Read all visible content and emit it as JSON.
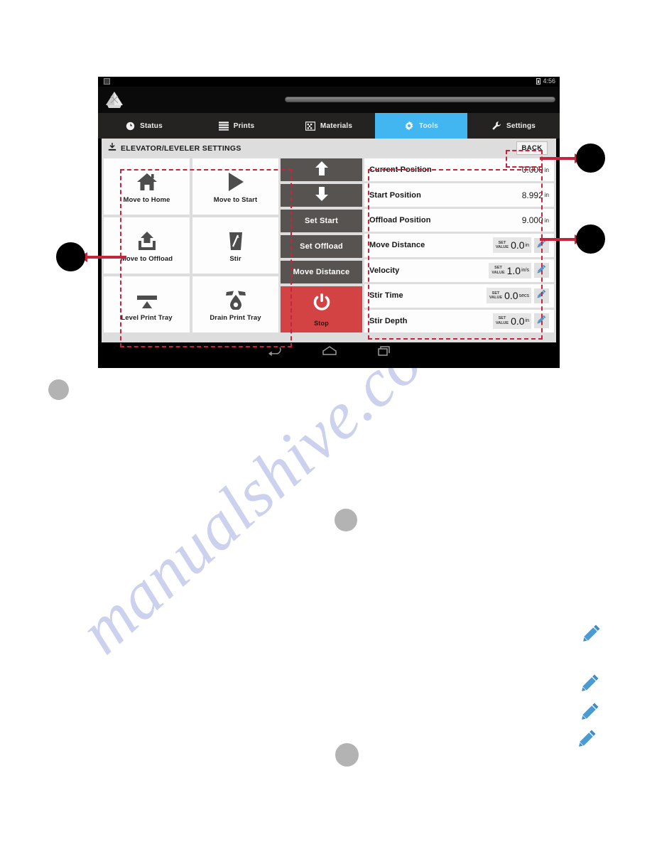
{
  "watermark": {
    "text": "manualshive.com"
  },
  "device": {
    "status_bar": {
      "time": "4:56",
      "battery_icon": "battery-icon",
      "notification_icon": "sim-card-icon"
    },
    "app_logo": "printer-logo-icon",
    "nav_bar": {
      "back": "back-nav-icon",
      "home": "home-nav-icon",
      "recents": "recents-nav-icon"
    }
  },
  "tabs": [
    {
      "label": "Status",
      "icon": "clock-icon",
      "active": false
    },
    {
      "label": "Prints",
      "icon": "list-icon",
      "active": false
    },
    {
      "label": "Materials",
      "icon": "material-icon",
      "active": false
    },
    {
      "label": "Tools",
      "icon": "gear-icon",
      "active": true
    },
    {
      "label": "Settings",
      "icon": "wrench-icon",
      "active": false
    }
  ],
  "page": {
    "title": "ELEVATOR/LEVELER SETTINGS",
    "title_icon": "elevator-icon",
    "back_label": "BACK"
  },
  "action_grid": [
    {
      "label": "Move to Home",
      "icon": "home-icon"
    },
    {
      "label": "Move to Start",
      "icon": "play-icon"
    },
    {
      "label": "Move to Offload",
      "icon": "upload-icon"
    },
    {
      "label": "Stir",
      "icon": "stir-cup-icon"
    },
    {
      "label": "Level Print Tray",
      "icon": "level-tray-icon"
    },
    {
      "label": "Drain Print Tray",
      "icon": "drain-drop-icon"
    }
  ],
  "jog_buttons": [
    {
      "label": "",
      "icon": "arrow-up-icon",
      "kind": "icon"
    },
    {
      "label": "",
      "icon": "arrow-down-icon",
      "kind": "icon"
    },
    {
      "label": "Set Start",
      "icon": "",
      "kind": "text"
    },
    {
      "label": "Set Offload",
      "icon": "",
      "kind": "text"
    },
    {
      "label": "Move Distance",
      "icon": "",
      "kind": "text"
    }
  ],
  "stop_button": {
    "label": "Stop",
    "icon": "power-icon",
    "color": "#d44343"
  },
  "settings_rows": [
    {
      "label": "Current Position",
      "type": "readonly",
      "value": "0.000",
      "unit": "in"
    },
    {
      "label": "Start Position",
      "type": "readonly",
      "value": "8.992",
      "unit": "in"
    },
    {
      "label": "Offload Position",
      "type": "readonly",
      "value": "9.000",
      "unit": "in"
    },
    {
      "label": "Move Distance",
      "type": "editable",
      "set_tag_line1": "SET",
      "set_tag_line2": "VALUE",
      "value": "0.0",
      "unit": "in",
      "edit_icon": "pencil-icon"
    },
    {
      "label": "Velocity",
      "type": "editable",
      "set_tag_line1": "SET",
      "set_tag_line2": "VALUE",
      "value": "1.0",
      "unit": "in/s",
      "edit_icon": "pencil-icon"
    },
    {
      "label": "Stir Time",
      "type": "editable",
      "set_tag_line1": "SET",
      "set_tag_line2": "VALUE",
      "value": "0.0",
      "unit": "secs",
      "edit_icon": "pencil-icon"
    },
    {
      "label": "Stir Depth",
      "type": "editable",
      "set_tag_line1": "SET",
      "set_tag_line2": "VALUE",
      "value": "0.0",
      "unit": "in",
      "edit_icon": "pencil-icon"
    }
  ],
  "annotations": {
    "accent_color": "#c4243c",
    "callout_color": "#000000",
    "callouts": [
      {
        "name": "callout-left-action-grid"
      },
      {
        "name": "callout-right-back"
      },
      {
        "name": "callout-right-settings-list"
      }
    ],
    "gray_dots": [
      {
        "name": "gray-dot-1"
      },
      {
        "name": "gray-dot-2"
      },
      {
        "name": "gray-dot-3"
      }
    ],
    "floating_pencils": [
      {
        "icon": "pencil-icon"
      },
      {
        "icon": "pencil-icon"
      },
      {
        "icon": "pencil-icon"
      },
      {
        "icon": "pencil-icon"
      }
    ]
  }
}
